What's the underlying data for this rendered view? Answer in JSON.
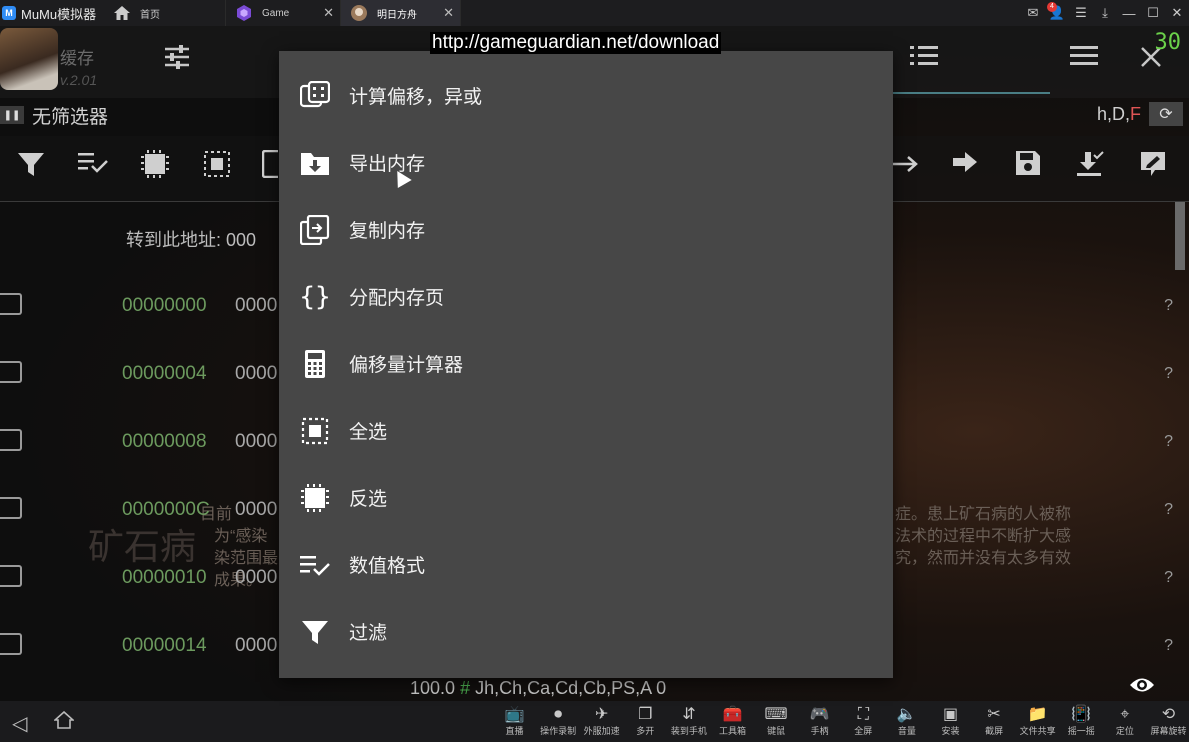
{
  "window": {
    "app_name": "MuMu模拟器",
    "tabs": [
      {
        "label": "首页"
      },
      {
        "label": "Game"
      },
      {
        "label": "明日方舟"
      }
    ],
    "notification_count": "4"
  },
  "screen": {
    "fps": "30",
    "cache_label": "缓存",
    "version_label": "v.2.01",
    "filter_label": "无筛选器",
    "type_flags": {
      "prefix": "h,D,",
      "f": "F"
    },
    "goto_label": "转到此地址:",
    "goto_value": "000",
    "rows": [
      {
        "address": "00000000",
        "value": "0000",
        "q": "?"
      },
      {
        "address": "00000004",
        "value": "0000",
        "q": "?"
      },
      {
        "address": "00000008",
        "value": "0000",
        "q": "?"
      },
      {
        "address": "0000000C",
        "value": "0000",
        "q": "?"
      },
      {
        "address": "00000010",
        "value": "0000",
        "q": "?"
      },
      {
        "address": "00000014",
        "value": "0000",
        "q": "?"
      }
    ],
    "status_value": "100.0",
    "status_hash": "#",
    "status_types": "Jh,Ch,Ca,Cd,Cb,PS,A 0",
    "bg_text_left": "矿石病",
    "bg_text_right_1": "症。患上矿石病的人被称",
    "bg_text_right_2": "法术的过程中不断扩大感",
    "bg_text_right_3": "究，然而并没有太多有效",
    "bg_text_left_2": "目前",
    "bg_text_left_3": "为“感染",
    "bg_text_left_4": "染范围最",
    "bg_text_left_5": "成果。"
  },
  "url_overlay": "http://gameguardian.net/download",
  "menu": {
    "items": [
      {
        "label": "计算偏移，异或",
        "icon": "calc-offset-icon"
      },
      {
        "label": "导出内存",
        "icon": "export-memory-icon"
      },
      {
        "label": "复制内存",
        "icon": "copy-memory-icon"
      },
      {
        "label": "分配内存页",
        "icon": "allocate-page-icon"
      },
      {
        "label": "偏移量计算器",
        "icon": "calculator-icon"
      },
      {
        "label": "全选",
        "icon": "select-all-icon"
      },
      {
        "label": "反选",
        "icon": "invert-selection-icon"
      },
      {
        "label": "数值格式",
        "icon": "value-format-icon"
      },
      {
        "label": "过滤",
        "icon": "filter-icon"
      }
    ]
  },
  "bottombar": {
    "tools": [
      {
        "label": "直播",
        "icon": "live-icon"
      },
      {
        "label": "操作录制",
        "icon": "record-icon"
      },
      {
        "label": "外服加速",
        "icon": "accelerate-icon"
      },
      {
        "label": "多开",
        "icon": "multi-instance-icon"
      },
      {
        "label": "装到手机",
        "icon": "install-phone-icon"
      },
      {
        "label": "工具箱",
        "icon": "toolbox-icon"
      },
      {
        "label": "键鼠",
        "icon": "keyboard-icon"
      },
      {
        "label": "手柄",
        "icon": "gamepad-icon"
      },
      {
        "label": "全屏",
        "icon": "fullscreen-icon"
      },
      {
        "label": "音量",
        "icon": "volume-icon"
      },
      {
        "label": "安装",
        "icon": "apk-install-icon"
      },
      {
        "label": "截屏",
        "icon": "screenshot-icon"
      },
      {
        "label": "文件共享",
        "icon": "file-share-icon"
      },
      {
        "label": "摇一摇",
        "icon": "shake-icon"
      },
      {
        "label": "定位",
        "icon": "location-icon"
      },
      {
        "label": "屏幕旋转",
        "icon": "rotate-icon"
      }
    ]
  }
}
